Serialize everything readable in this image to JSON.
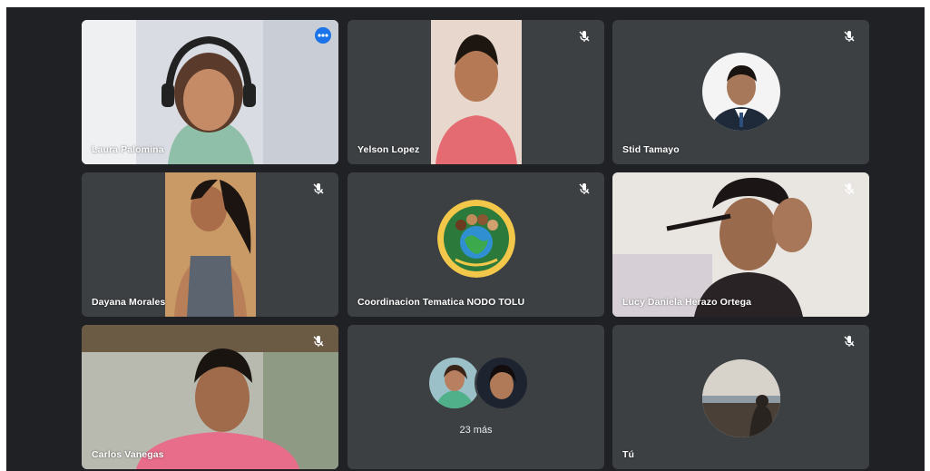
{
  "meeting": {
    "participants": [
      {
        "name": "Laura Palomina",
        "muted": false,
        "active_speaker": true,
        "media": "camera"
      },
      {
        "name": "Yelson Lopez",
        "muted": true,
        "media": "camera"
      },
      {
        "name": "Stid Tamayo",
        "muted": true,
        "media": "profile-photo"
      },
      {
        "name": "Dayana Morales",
        "muted": true,
        "media": "camera"
      },
      {
        "name": "Coordinacion Tematica NODO TOLU",
        "muted": true,
        "media": "logo"
      },
      {
        "name": "Lucy Daniela Herazo Ortega",
        "muted": true,
        "media": "camera"
      },
      {
        "name": "Carlos Vanegas",
        "muted": true,
        "media": "camera"
      },
      {
        "name": "",
        "muted": false,
        "media": "overflow"
      },
      {
        "name": "Tú",
        "muted": true,
        "media": "profile-photo"
      }
    ],
    "overflow_label": "23 más"
  },
  "colors": {
    "background": "#202124",
    "tile": "#3c4043",
    "active_border": "#8ab4f8",
    "menu_button": "#1a73e8"
  },
  "icons": {
    "mic_off": "mic-off-icon",
    "more_options": "more-options-icon"
  }
}
